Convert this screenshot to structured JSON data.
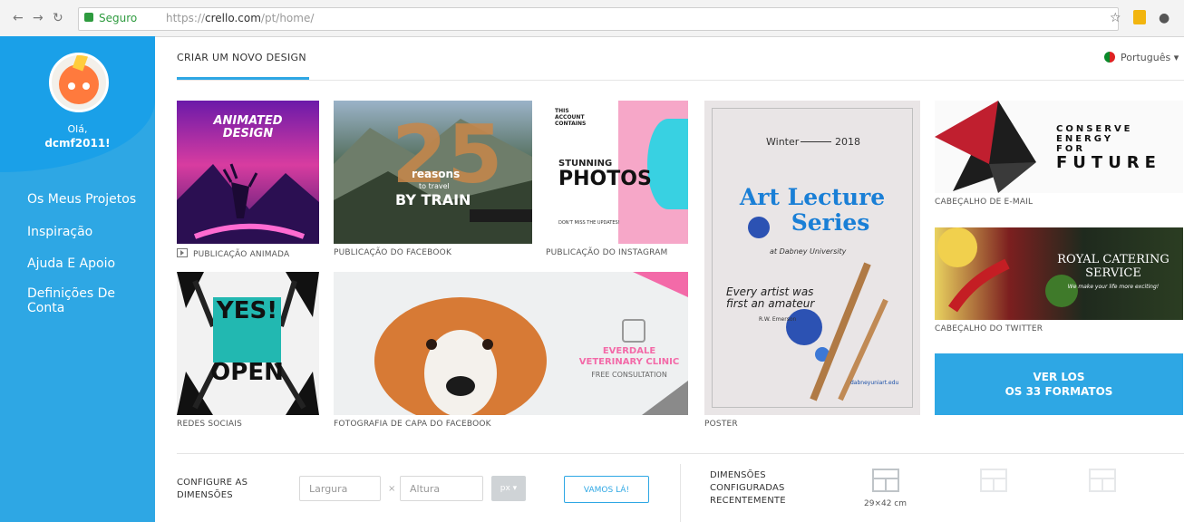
{
  "browser": {
    "secure_label": "Seguro",
    "url_prefix": "https://",
    "url_domain": "crello.com",
    "url_path": "/pt/home/"
  },
  "sidebar": {
    "greeting": "Olá,",
    "username": "dcmf2011!",
    "items": [
      {
        "label": "Os Meus Projetos"
      },
      {
        "label": "Inspiração"
      },
      {
        "label": "Ajuda E Apoio"
      },
      {
        "label": "Definições De Conta"
      }
    ]
  },
  "header": {
    "tab_label": "CRIAR UM NOVO DESIGN",
    "language": "Português"
  },
  "tiles": [
    {
      "caption": "PUBLICAÇÃO ANIMADA",
      "text": [
        "ANIMATED",
        "DESIGN"
      ]
    },
    {
      "caption": "PUBLICAÇÃO DO FACEBOOK",
      "text": [
        "25",
        "reasons",
        "to travel",
        "BY TRAIN"
      ]
    },
    {
      "caption": "PUBLICAÇÃO DO INSTAGRAM",
      "text": [
        "THIS",
        "ACCOUNT",
        "CONTAINS",
        "STUNNING",
        "PHOTOS",
        "DON'T MISS THE UPDATES!"
      ]
    },
    {
      "caption": "REDES SOCIAIS",
      "text": [
        "YES!",
        "OPEN"
      ]
    },
    {
      "caption": "FOTOGRAFIA DE CAPA DO FACEBOOK",
      "text": [
        "EVERDALE",
        "VETERINARY CLINIC",
        "FREE CONSULTATION"
      ]
    },
    {
      "caption": "POSTER",
      "text": [
        "Winter",
        "2018",
        "Art Lecture",
        "Series",
        "at Dabney University",
        "Every artist was",
        "first an amateur",
        "R.W. Emerson",
        "dabneyuniart.edu"
      ]
    },
    {
      "caption": "CABEÇALHO DE E-MAIL",
      "text": [
        "CONSERVE",
        "ENERGY",
        "FOR",
        "FUTURE"
      ]
    },
    {
      "caption": "CABEÇALHO DO TWITTER",
      "text": [
        "ROYAL CATERING",
        "SERVICE",
        "We make your life more exciting!"
      ]
    }
  ],
  "cta": {
    "line1": "VER LOS",
    "line2": "OS 33 FORMATOS"
  },
  "config": {
    "label_line1": "CONFIGURE AS",
    "label_line2": "DIMENSÕES",
    "width_placeholder": "Largura",
    "height_placeholder": "Altura",
    "times": "×",
    "unit": "px ▾",
    "go_label": "VAMOS LÁ!"
  },
  "recent": {
    "label_line1": "DIMENSÕES",
    "label_line2": "CONFIGURADAS",
    "label_line3": "RECENTEMENTE",
    "size": "29×42 cm"
  },
  "colors": {
    "accent": "#2ea7e4"
  }
}
